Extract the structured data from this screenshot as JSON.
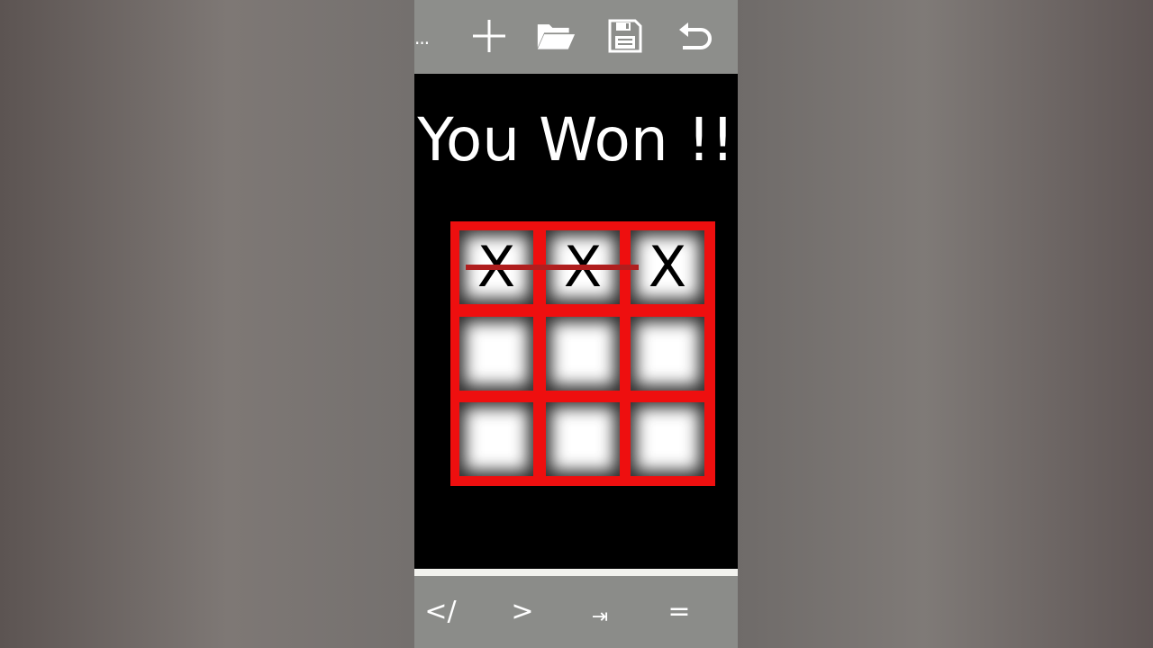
{
  "toolbar": {
    "more_label": "...",
    "icons": [
      "plus-icon",
      "folder-icon",
      "save-icon",
      "undo-icon"
    ]
  },
  "game": {
    "title": "You Won !!",
    "board": [
      "X",
      "X",
      "X",
      "",
      "",
      "",
      "",
      "",
      ""
    ],
    "win_row": 1,
    "colors": {
      "board": "#ee0f0f",
      "win_line": "#b01e1e",
      "cell": "#ffffff"
    }
  },
  "bottom_keys": [
    "</",
    ">",
    "⇥",
    "="
  ]
}
